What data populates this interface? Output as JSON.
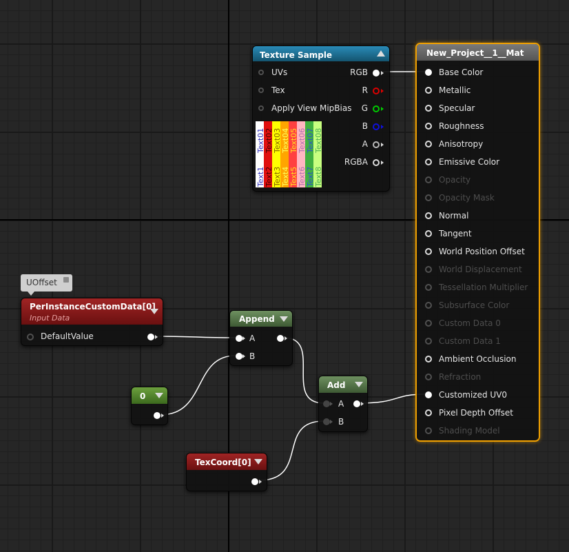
{
  "comment": {
    "label": "UOffset"
  },
  "texture_sample": {
    "title": "Texture Sample",
    "inputs": [
      "UVs",
      "Tex",
      "Apply View MipBias"
    ],
    "outputs": [
      "RGB",
      "R",
      "G",
      "B",
      "A",
      "RGBA"
    ],
    "preview_labels": {
      "top": [
        "Text01",
        "Text02",
        "Text03",
        "Text04",
        "Text05",
        "Text06",
        "Text07",
        "Text08"
      ],
      "bottom": [
        "Text1",
        "Text2",
        "Text3",
        "Text4",
        "Text5",
        "Text6",
        "Text7",
        "Text8"
      ]
    },
    "colors": {
      "title_bar": "#1b6f96",
      "r": "#dd0000",
      "g": "#00cc00",
      "b": "#0000dd"
    },
    "preview_colors": [
      "#ffffff",
      "#ee1c24",
      "#ffff00",
      "#ffa500",
      "#ff3333",
      "#ffb6c1",
      "#4caf50",
      "#c8ff80"
    ]
  },
  "material": {
    "title": "New_Project__1__Mat",
    "inputs": [
      {
        "label": "Base Color",
        "enabled": true
      },
      {
        "label": "Metallic",
        "enabled": true
      },
      {
        "label": "Specular",
        "enabled": true
      },
      {
        "label": "Roughness",
        "enabled": true
      },
      {
        "label": "Anisotropy",
        "enabled": true
      },
      {
        "label": "Emissive Color",
        "enabled": true
      },
      {
        "label": "Opacity",
        "enabled": false
      },
      {
        "label": "Opacity Mask",
        "enabled": false
      },
      {
        "label": "Normal",
        "enabled": true
      },
      {
        "label": "Tangent",
        "enabled": true
      },
      {
        "label": "World Position Offset",
        "enabled": true
      },
      {
        "label": "World Displacement",
        "enabled": false
      },
      {
        "label": "Tessellation Multiplier",
        "enabled": false
      },
      {
        "label": "Subsurface Color",
        "enabled": false
      },
      {
        "label": "Custom Data 0",
        "enabled": false
      },
      {
        "label": "Custom Data 1",
        "enabled": false
      },
      {
        "label": "Ambient Occlusion",
        "enabled": true
      },
      {
        "label": "Refraction",
        "enabled": false
      },
      {
        "label": "Customized UV0",
        "enabled": true
      },
      {
        "label": "Pixel Depth Offset",
        "enabled": true
      },
      {
        "label": "Shading Model",
        "enabled": false
      }
    ],
    "colors": {
      "selection": "#f0a000",
      "title_bar": "#6a6a6a"
    }
  },
  "per_instance": {
    "title": "PerInstanceCustomData[0]",
    "subtitle": "Input Data",
    "output": "DefaultValue",
    "colors": {
      "title_bar": "#8e1a1a"
    }
  },
  "append": {
    "title": "Append",
    "inputs": [
      "A",
      "B"
    ],
    "colors": {
      "title_bar": "#4e6e44"
    }
  },
  "constant": {
    "title": "0",
    "colors": {
      "title_bar": "#4e7a2e"
    }
  },
  "add": {
    "title": "Add",
    "inputs": [
      "A",
      "B"
    ],
    "colors": {
      "title_bar": "#4e6e44"
    }
  },
  "texcoord": {
    "title": "TexCoord[0]",
    "colors": {
      "title_bar": "#8e1a1a"
    }
  }
}
